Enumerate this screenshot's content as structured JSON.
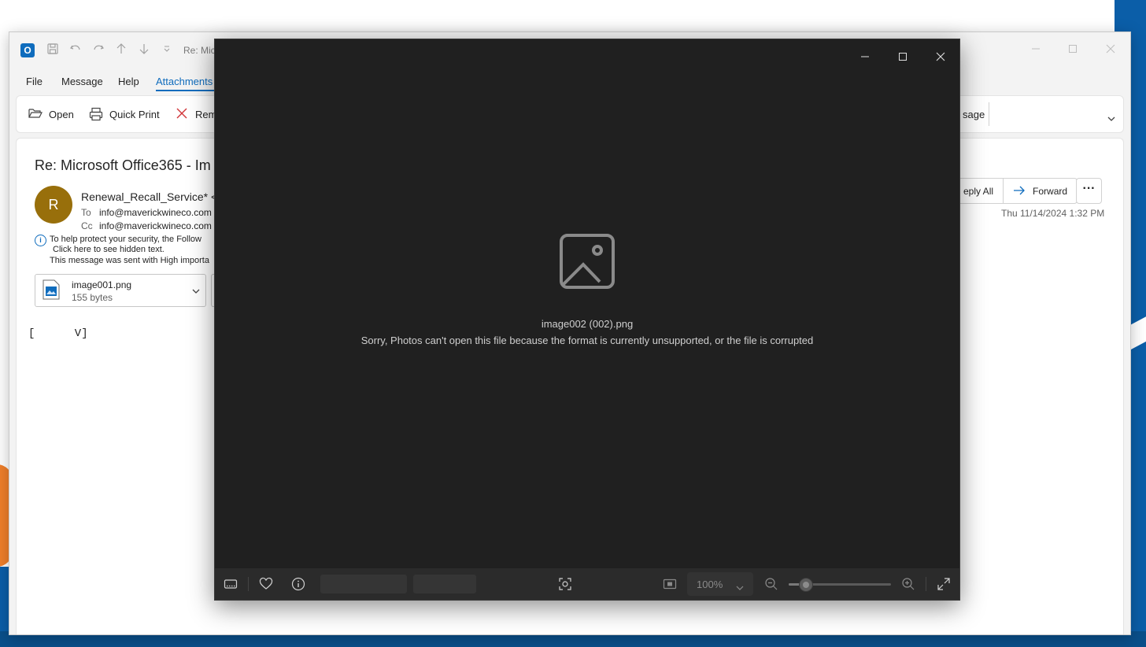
{
  "outlook": {
    "title": "Re: Mic",
    "logo_letter": "O",
    "menu": [
      "File",
      "Message",
      "Help",
      "Attachments"
    ],
    "ribbon": {
      "open_label": "Open",
      "quick_print_label": "Quick Print",
      "remove_label": "Rem",
      "message_partial_label": "sage"
    },
    "email": {
      "subject": "Re: Microsoft Office365 - Im",
      "avatar_letter": "R",
      "sender": "Renewal_Recall_Service* <",
      "to_label": "To",
      "to_value": "info@maverickwineco.com",
      "cc_label": "Cc",
      "cc_value": "info@maverickwineco.com",
      "info_lines": [
        "To help protect your security, the Follow",
        "Click here to see hidden text.",
        "This message was sent with High importa"
      ],
      "reply_all_label": "eply All",
      "forward_label": "Forward",
      "date": "Thu 11/14/2024 1:32 PM",
      "attachment": {
        "name": "image001.png",
        "size": "155 bytes"
      },
      "body": "[      V]"
    }
  },
  "photos": {
    "filename": "image002 (002).png",
    "error_message": "Sorry, Photos can't open this file because the format is currently unsupported, or the file is corrupted",
    "zoom_level": "100%",
    "zoom_slider_fraction": 0.17
  },
  "colors": {
    "outlook_accent": "#0f6cbd",
    "avatar_bg": "#986f0b",
    "photos_bg": "#202020",
    "photos_toolbar": "#2b2b2b"
  },
  "icons": [
    "outlook-logo-icon",
    "save-icon",
    "undo-icon",
    "redo-icon",
    "up-arrow-icon",
    "down-arrow-icon",
    "folder-open-icon",
    "printer-icon",
    "remove-x-icon",
    "info-icon",
    "image-file-icon",
    "chevron-down-icon",
    "forward-arrow-icon",
    "more-icon",
    "image-placeholder-icon",
    "filmstrip-icon",
    "heart-icon",
    "info-circle-icon",
    "focus-icon",
    "fit-to-window-icon",
    "zoom-out-icon",
    "zoom-in-icon",
    "fullscreen-icon"
  ]
}
